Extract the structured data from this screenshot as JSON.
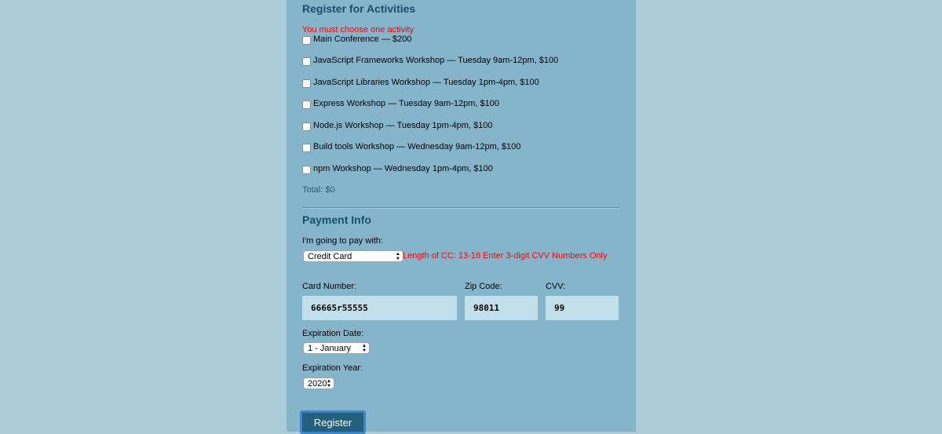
{
  "activities": {
    "heading": "Register for Activities",
    "error": "You must choose one activity",
    "items": [
      {
        "label": "Main Conference — $200",
        "checked": false
      },
      {
        "label": "JavaScript Frameworks Workshop — Tuesday 9am-12pm, $100",
        "checked": false
      },
      {
        "label": "JavaScript Libraries Workshop — Tuesday 1pm-4pm, $100",
        "checked": false
      },
      {
        "label": "Express Workshop — Tuesday 9am-12pm, $100",
        "checked": false
      },
      {
        "label": "Node.js Workshop — Tuesday 1pm-4pm, $100",
        "checked": false
      },
      {
        "label": "Build tools Workshop — Wednesday 9am-12pm, $100",
        "checked": false
      },
      {
        "label": "npm Workshop — Wednesday 1pm-4pm, $100",
        "checked": false
      }
    ],
    "total": "Total: $0"
  },
  "payment": {
    "heading": "Payment Info",
    "pay_label": "I'm going to pay with:",
    "pay_selected": "Credit Card",
    "error": "Length of CC: 13-16 Enter 3-digit CVV Numbers Only",
    "card_number_label": "Card Number:",
    "card_number_value": "66665r55555",
    "zip_label": "Zip Code:",
    "zip_value": "98011",
    "cvv_label": "CVV:",
    "cvv_value": "99",
    "exp_date_label": "Expiration Date:",
    "exp_date_selected": "1 - January",
    "exp_year_label": "Expiration Year:",
    "exp_year_selected": "2020"
  },
  "submit_label": "Register",
  "colors": {
    "page_bg": "#aacbd7",
    "panel_bg": "#85b5cb",
    "heading": "#184f68",
    "error": "#ff0000",
    "input_bg": "#c1e0ea",
    "button_bg": "#22607e",
    "button_border": "#3b86c9"
  }
}
